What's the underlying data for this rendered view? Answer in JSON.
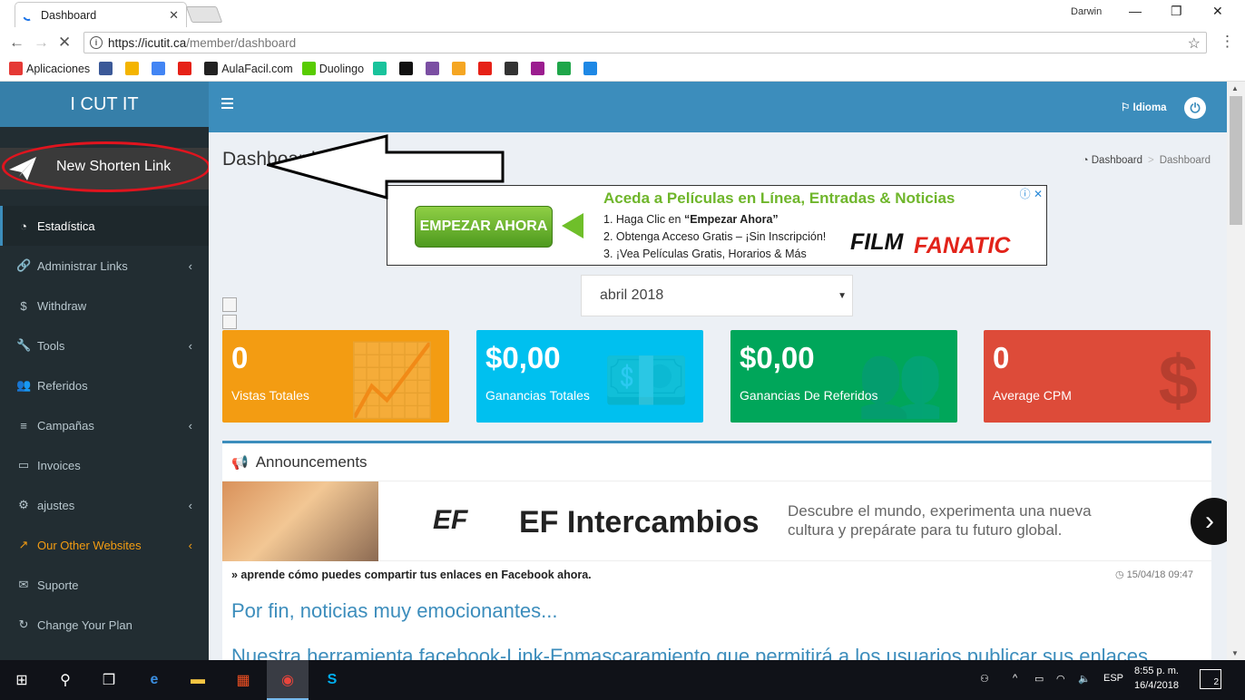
{
  "browser": {
    "tab_title": "Dashboard",
    "user": "Darwin",
    "url_host": "https://icutit.ca",
    "url_path": "/member/dashboard",
    "bookmarks": [
      {
        "label": "Aplicaciones",
        "icon": "apps-grid-icon",
        "color": "#e53935"
      },
      {
        "label": "",
        "icon": "facebook-icon",
        "color": "#3b5998"
      },
      {
        "label": "",
        "icon": "star-bookmark-icon",
        "color": "#f4b400"
      },
      {
        "label": "",
        "icon": "translate-icon",
        "color": "#4285f4"
      },
      {
        "label": "",
        "icon": "youtube-icon",
        "color": "#e62117"
      },
      {
        "label": "AulaFacil.com",
        "icon": "aulafacil-icon",
        "color": "#222222"
      },
      {
        "label": "Duolingo",
        "icon": "duolingo-icon",
        "color": "#58cc02"
      },
      {
        "label": "",
        "icon": "circle-green-icon",
        "color": "#19c39c"
      },
      {
        "label": "",
        "icon": "l-icon",
        "color": "#111111"
      },
      {
        "label": "",
        "icon": "purple-circle-icon",
        "color": "#7b4fa3"
      },
      {
        "label": "",
        "icon": "flame-icon",
        "color": "#f5a623"
      },
      {
        "label": "",
        "icon": "youtube-icon",
        "color": "#e62117"
      },
      {
        "label": "",
        "icon": "af-icon",
        "color": "#333333"
      },
      {
        "label": "",
        "icon": "s-icon",
        "color": "#9b1d8f"
      },
      {
        "label": "",
        "icon": "x-icon",
        "color": "#1fa64a"
      },
      {
        "label": "",
        "icon": "play-icon",
        "color": "#1e88e5"
      }
    ]
  },
  "sidebar": {
    "brand": "I CUT IT",
    "new_link_label": "New Shorten Link",
    "items": [
      {
        "label": "Estadística",
        "icon": "dashboard-icon",
        "glyph": "◔",
        "active": true,
        "caret": false
      },
      {
        "label": "Administrar Links",
        "icon": "link-icon",
        "glyph": "🔗",
        "caret": true
      },
      {
        "label": "Withdraw",
        "icon": "dollar-icon",
        "glyph": "$",
        "caret": false
      },
      {
        "label": "Tools",
        "icon": "wrench-icon",
        "glyph": "🔧",
        "caret": true
      },
      {
        "label": "Referidos",
        "icon": "users-icon",
        "glyph": "👥",
        "caret": false
      },
      {
        "label": "Campañas",
        "icon": "database-icon",
        "glyph": "≡",
        "caret": true
      },
      {
        "label": "Invoices",
        "icon": "credit-card-icon",
        "glyph": "▭",
        "caret": false
      },
      {
        "label": "ajustes",
        "icon": "gears-icon",
        "glyph": "⚙",
        "caret": true
      },
      {
        "label": "Our Other Websites",
        "icon": "external-link-icon",
        "glyph": "↗",
        "caret": true,
        "yellow": true
      },
      {
        "label": "Suporte",
        "icon": "envelope-icon",
        "glyph": "✉",
        "caret": false
      },
      {
        "label": "Change Your Plan",
        "icon": "refresh-icon",
        "glyph": "↻",
        "caret": false
      }
    ]
  },
  "topnav": {
    "idioma": "Idioma"
  },
  "content": {
    "page_title": "Dashboard",
    "breadcrumb_home": "Dashboard",
    "breadcrumb_current": "Dashboard",
    "ad": {
      "cta": "EMPEZAR AHORA",
      "headline": "Aceda a Películas en Línea, Entradas & Noticias",
      "step1_prefix": "1. Haga Clic en ",
      "step1_bold": "“Empezar Ahora”",
      "step2": "2. Obtenga Acceso Gratis – ¡Sin Inscripción!",
      "step3": "3. ¡Vea Películas Gratis, Horarios & Más",
      "brand1": "FILM",
      "brand2": "FANATIC"
    },
    "month": "abril 2018",
    "stats": [
      {
        "value": "0",
        "label": "Vistas Totales",
        "color": "#f39c12",
        "icon": "chart-up-icon",
        "glyph": "📈"
      },
      {
        "value": "$0,00",
        "label": "Ganancias Totales",
        "color": "#00c0ef",
        "icon": "money-icon",
        "glyph": "💵"
      },
      {
        "value": "$0,00",
        "label": "Ganancias De Referidos",
        "color": "#00a65a",
        "icon": "users-icon",
        "glyph": "👥"
      },
      {
        "value": "0",
        "label": "Average CPM",
        "color": "#dd4b39",
        "icon": "dollar-icon",
        "glyph": "$"
      }
    ],
    "announcements": {
      "title": "Announcements",
      "ef_logo": "EF",
      "ef_title": "EF Intercambios",
      "ef_desc": "Descubre el mundo, experimenta una nueva cultura y prepárate para tu futuro global.",
      "line": "» aprende cómo puedes compartir tus enlaces en Facebook ahora.",
      "date": "15/04/18 09:47",
      "heading1": "Por fin, noticias muy emocionantes...",
      "heading2": "Nuestra herramienta facebook-Link-Enmascaramiento que permitirá a los usuarios publicar sus enlaces"
    }
  },
  "taskbar": {
    "lang": "ESP",
    "time": "8:55 p. m.",
    "date": "16/4/2018",
    "notifications": "2"
  }
}
